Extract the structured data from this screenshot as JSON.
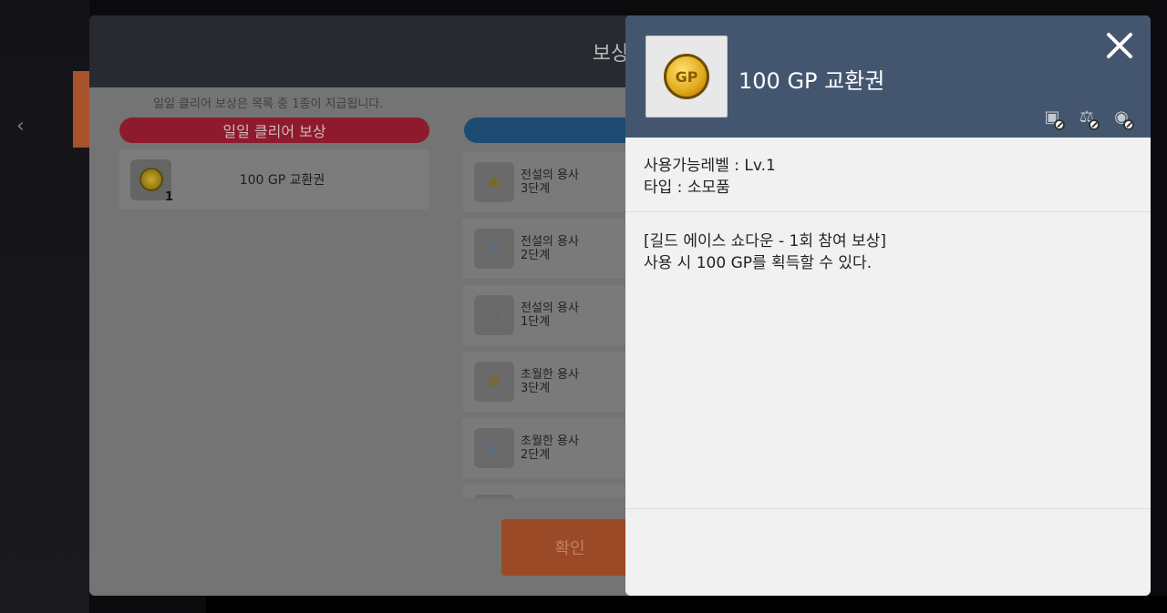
{
  "background": {
    "back_icon": "chevron-left-icon"
  },
  "reward_dialog": {
    "title": "보상",
    "note": "일일 클리어 보상은 목록 중 1종이 지급됩니다.",
    "daily_section_label": "일일 클리어 보상",
    "daily_reward": {
      "name": "100 GP 교환권",
      "count": "1",
      "icon": "gp-coin-icon"
    },
    "ranked_rewards": [
      {
        "line1": "전설의 용사",
        "line2": "3단계",
        "icon": "gold-stars-icon"
      },
      {
        "line1": "전설의 용사",
        "line2": "2단계",
        "icon": "silver-stars-icon"
      },
      {
        "line1": "전설의 용사",
        "line2": "1단계",
        "icon": "bronze-star-icon"
      },
      {
        "line1": "초월한 용사",
        "line2": "3단계",
        "icon": "gold-crown-icon"
      },
      {
        "line1": "초월한 용사",
        "line2": "2단계",
        "icon": "silver-crown-icon"
      }
    ],
    "confirm_label": "확인"
  },
  "tooltip": {
    "title": "100 GP 교환권",
    "icon_text": "GP",
    "trade_restrictions": [
      "no-trade-icon",
      "no-sell-icon",
      "no-storage-icon"
    ],
    "level_line": "사용가능레벨 : Lv.1",
    "type_line": "타입 : 소모품",
    "desc_line1": "[길드 에이스 쇼다운 - 1회 참여 보상]",
    "desc_line2": "사용 시 100 GP를 획득할 수 있다."
  }
}
